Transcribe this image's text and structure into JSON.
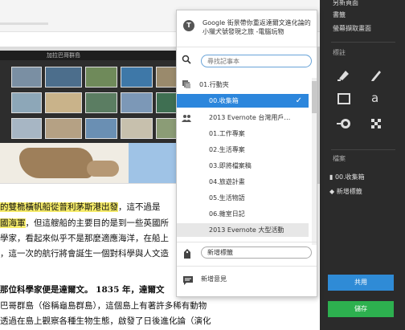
{
  "article": {
    "photo_bar_title": "加拉巴哥群島",
    "lines": [
      {
        "hl": "的雙桅橫帆船從普利茅斯港出發",
        "rest": "，這不過是"
      },
      {
        "hl": "國海軍",
        "rest": "，但這艘船的主要目的是到一些英國所"
      },
      {
        "hl": "",
        "rest": "學家，看起來似乎不是那麼適應海洋，在船上"
      },
      {
        "hl": "",
        "rest": "，這一次的航行將會誕生一個對科學與人文造"
      },
      {
        "hl": "",
        "rest": "那位科學家便是達爾文。 1835 年，達爾文"
      },
      {
        "hl": "",
        "rest": "巴哥群島（俗稱龜島群島），這個島上有著許多稀有動物"
      },
      {
        "hl": "",
        "rest": "透過在島上觀察各種生物生態，啟發了日後進化論（演化"
      }
    ]
  },
  "right_panel": {
    "top_links": [
      "另新頁面",
      "書籤",
      "螢幕擷取畫面"
    ],
    "annotate_heading": "標註",
    "annotate_tools": [
      "highlighter-icon",
      "pen-icon",
      "rectangle-icon",
      "text-icon",
      "stamp-icon",
      "pixelate-icon"
    ],
    "files_heading": "檔案",
    "notebook_label": "00.收集箱",
    "add_tag_label": "新增標籤",
    "share_label": "共用",
    "save_label": "儲存"
  },
  "popup": {
    "page_title": "Google 街景帶你重返達爾文進化論的小獵犬號發現之旅 -電腦玩物",
    "search_placeholder": "尋找記事本",
    "notebooks": [
      {
        "label": "01.行動夾",
        "icon": "stack-icon",
        "indent": 0,
        "state": "normal"
      },
      {
        "label": "00.收集箱",
        "icon": "",
        "indent": 1,
        "state": "selected"
      },
      {
        "label": "2013 Evernote 台灣用戶…",
        "icon": "shared-people-icon",
        "indent": 0,
        "state": "normal"
      },
      {
        "label": "01.工作專案",
        "icon": "",
        "indent": 1,
        "state": "normal"
      },
      {
        "label": "02.生活專案",
        "icon": "",
        "indent": 1,
        "state": "normal"
      },
      {
        "label": "03.即將檔案稿",
        "icon": "",
        "indent": 1,
        "state": "normal"
      },
      {
        "label": "04.旅遊計畫",
        "icon": "",
        "indent": 1,
        "state": "normal"
      },
      {
        "label": "05.生活物語",
        "icon": "",
        "indent": 1,
        "state": "normal"
      },
      {
        "label": "06.雜室日記",
        "icon": "",
        "indent": 1,
        "state": "normal"
      },
      {
        "label": "2013 Evernote 大型活動",
        "icon": "",
        "indent": 1,
        "state": "hover"
      }
    ],
    "tag_placeholder": "新增標籤",
    "note_label": "新增意見",
    "colors": {
      "selected": "#2c86dc",
      "search_border": "#6aa4d8"
    }
  }
}
